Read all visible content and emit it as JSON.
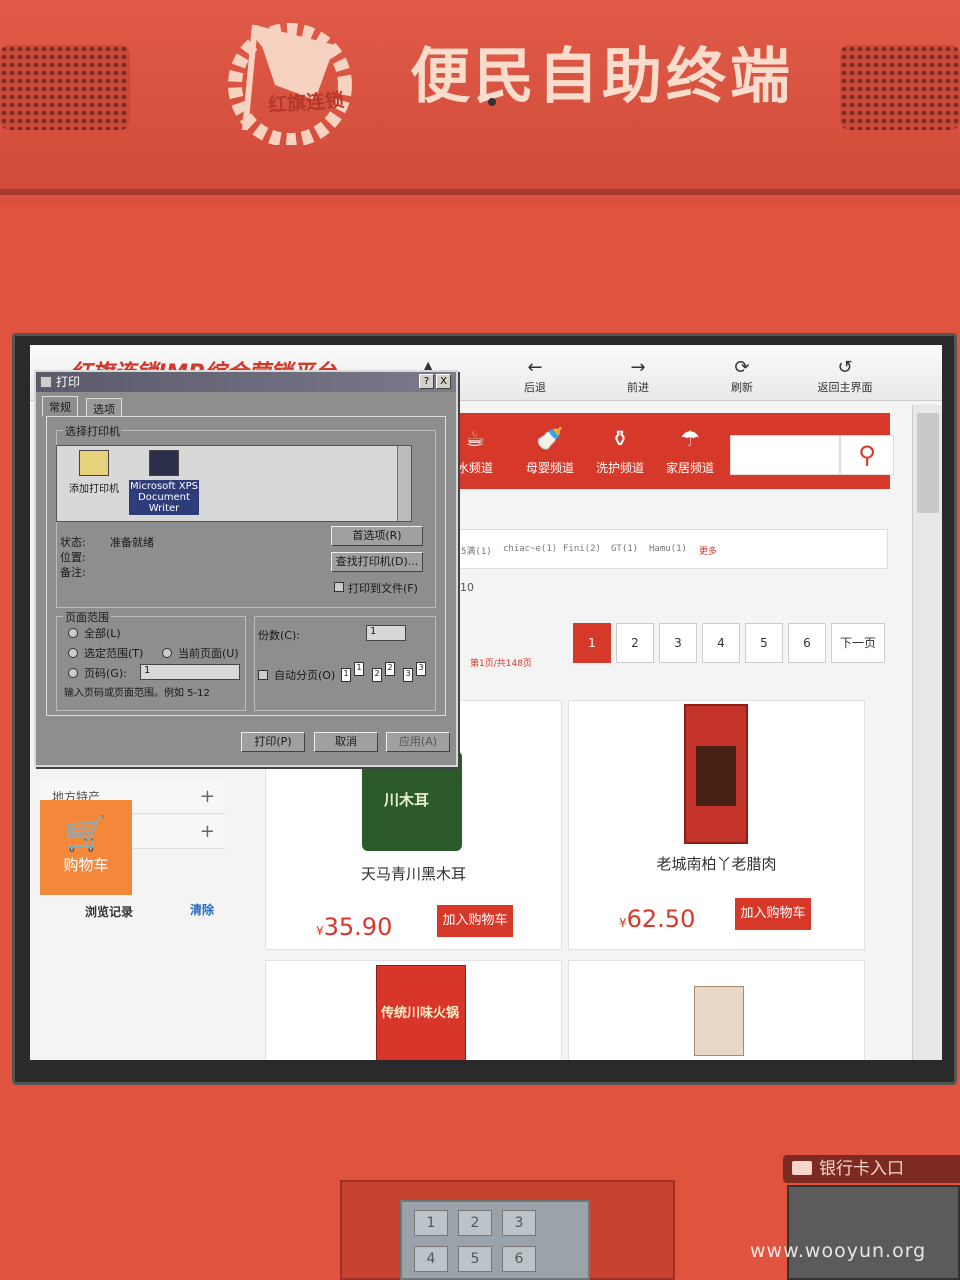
{
  "kiosk": {
    "title": "便民自助终端",
    "logo_text": "红旗连锁",
    "card_slot_label": "银行卡入口",
    "pinpad_keys": [
      "1",
      "2",
      "3",
      "4",
      "5",
      "6"
    ],
    "watermark": "www.wooyun.org"
  },
  "browser": {
    "site_title": "红旗连锁IMP综合营销平台",
    "nav": [
      {
        "icon": "back-arrow-icon",
        "glyph": "←",
        "label": "后退"
      },
      {
        "icon": "forward-arrow-icon",
        "glyph": "→",
        "label": "前进"
      },
      {
        "icon": "refresh-icon",
        "glyph": "⟳",
        "label": "刷新"
      },
      {
        "icon": "home-return-icon",
        "glyph": "↺",
        "label": "返回主界面"
      }
    ]
  },
  "store": {
    "categories": [
      {
        "icon": "cup-icon",
        "glyph": "☕",
        "label": "水频道"
      },
      {
        "icon": "bottle-icon",
        "glyph": "🍼",
        "label": "母婴频道"
      },
      {
        "icon": "cosmetics-icon",
        "glyph": "⚱",
        "label": "洗护频道"
      },
      {
        "icon": "umbrella-icon",
        "glyph": "☂",
        "label": "家居频道"
      }
    ],
    "search_icon": "search-icon",
    "brands": [
      "5满(1)",
      "chiac~e(1)",
      "Fini(2)",
      "GT(1)",
      "Hamu(1)"
    ],
    "brand_more": "更多",
    "result_count": "10",
    "pager_info": "第1页/共148页",
    "pages": [
      "1",
      "2",
      "3",
      "4",
      "5",
      "6"
    ],
    "next_page": "下一页",
    "sidebar_rows": [
      "地方特产",
      ""
    ],
    "cart_label": "购物车",
    "history_label": "浏览记录",
    "history_clear": "清除",
    "products": [
      {
        "name": "天马青川黑木耳",
        "currency": "¥",
        "price": "35.90",
        "add_label": "加入购物车",
        "img_label": "川木耳"
      },
      {
        "name": "老城南柏丫老腊肉",
        "currency": "¥",
        "price": "62.50",
        "add_label": "加入购物车",
        "img_label": ""
      },
      {
        "name": "",
        "currency": "",
        "price": "",
        "add_label": "",
        "img_label": "传统川味火锅"
      },
      {
        "name": "",
        "currency": "",
        "price": "",
        "add_label": "",
        "img_label": ""
      }
    ]
  },
  "print_dialog": {
    "title": "打印",
    "help_btn": "?",
    "close_btn": "X",
    "tabs": [
      "常规",
      "选项"
    ],
    "select_printer_group": "选择打印机",
    "printers": [
      {
        "icon": "add-printer-icon",
        "label": "添加打印机"
      },
      {
        "icon": "xps-printer-icon",
        "label": "Microsoft XPS Document Writer"
      }
    ],
    "status_label": "状态:",
    "status_value": "准备就绪",
    "location_label": "位置:",
    "comment_label": "备注:",
    "preferences_btn": "首选项(R)",
    "find_printer_btn": "查找打印机(D)...",
    "print_to_file": "打印到文件(F)",
    "page_range_group": "页面范围",
    "range_all": "全部(L)",
    "range_selection": "选定范围(T)",
    "range_current": "当前页面(U)",
    "range_pages": "页码(G):",
    "range_pages_value": "1",
    "range_hint": "输入页码或页面范围。例如 5-12",
    "copies_label": "份数(C):",
    "copies_value": "1",
    "collate_label": "自动分页(O)",
    "print_btn": "打印(P)",
    "cancel_btn": "取消",
    "apply_btn": "应用(A)"
  }
}
